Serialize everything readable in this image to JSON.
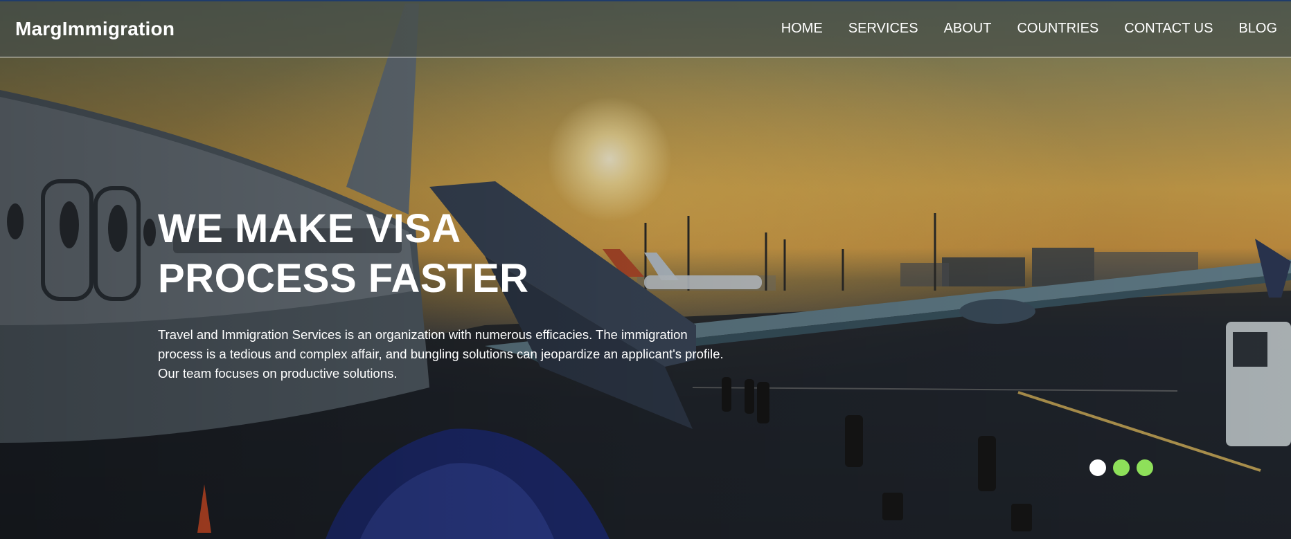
{
  "brand": {
    "name": "MargImmigration"
  },
  "nav": {
    "items": [
      {
        "label": "HOME"
      },
      {
        "label": "SERVICES"
      },
      {
        "label": "ABOUT"
      },
      {
        "label": "COUNTRIES"
      },
      {
        "label": "CONTACT US"
      },
      {
        "label": "BLOG"
      }
    ]
  },
  "hero": {
    "title_line1": "WE MAKE VISA",
    "title_line2": "PROCESS FASTER",
    "description": "Travel and Immigration Services is an organization with numerous efficacies. The immigration process is a tedious and complex affair, and bungling solutions can jeopardize an applicant's profile. Our team focuses on productive solutions."
  },
  "slider": {
    "dots": [
      {
        "state": "active",
        "color": "#ffffff"
      },
      {
        "state": "inactive",
        "color": "#8ee05a"
      },
      {
        "state": "inactive",
        "color": "#8ee05a"
      }
    ]
  },
  "colors": {
    "navbar_border_top": "#1f3c6b",
    "text": "#ffffff",
    "dot_inactive": "#8ee05a"
  }
}
